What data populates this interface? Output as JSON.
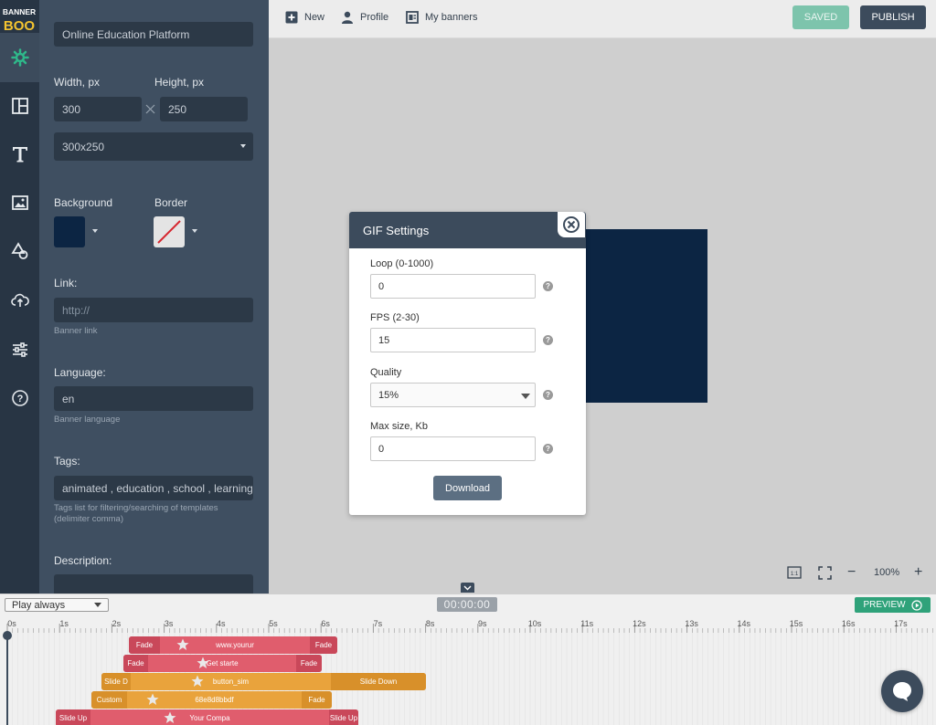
{
  "brand": {
    "logo_text_1": "BANNER",
    "logo_text_2": "BOO"
  },
  "rail": {
    "items": [
      "settings-icon",
      "layout-icon",
      "text-icon",
      "image-icon",
      "shapes-icon",
      "upload-icon",
      "sliders-icon",
      "help-icon"
    ]
  },
  "panel": {
    "banner_name": "Online Education Platform",
    "width_label": "Width, px",
    "height_label": "Height, px",
    "width_value": "300",
    "height_value": "250",
    "size_preset": "300x250",
    "background_label": "Background",
    "border_label": "Border",
    "background_color": "#0c2543",
    "link_label": "Link:",
    "link_placeholder": "http://",
    "link_hint": "Banner link",
    "language_label": "Language:",
    "language_value": "en",
    "language_hint": "Banner language",
    "tags_label": "Tags:",
    "tags_value": "animated , education , school , learning ,",
    "tags_hint": "Tags list for filtering/searching of templates (delimiter comma)",
    "description_label": "Description:"
  },
  "topbar": {
    "new_label": "New",
    "profile_label": "Profile",
    "my_banners_label": "My banners",
    "saved_label": "SAVED",
    "publish_label": "PUBLISH"
  },
  "zoom": {
    "value": "100%",
    "minus": "−",
    "plus": "+",
    "fit_label": "1:1"
  },
  "modal": {
    "title": "GIF Settings",
    "loop_label": "Loop (0-1000)",
    "loop_value": "0",
    "fps_label": "FPS (2-30)",
    "fps_value": "15",
    "quality_label": "Quality",
    "quality_value": "15%",
    "max_size_label": "Max size, Kb",
    "max_size_value": "0",
    "help_glyph": "?",
    "download_label": "Download"
  },
  "timeline": {
    "play_mode": "Play always",
    "timecode": "00:00:00",
    "preview_label": "PREVIEW",
    "ticks": [
      "0s",
      "1s",
      "2s",
      "3s",
      "4s",
      "5s",
      "6s",
      "7s",
      "8s",
      "9s",
      "10s",
      "11s",
      "12s",
      "13s",
      "14s",
      "15s",
      "16s",
      "17s"
    ],
    "layers": [
      {
        "name": "www.yourur",
        "in": "Fade",
        "out": "Fade",
        "color": "red"
      },
      {
        "name": "Get starte",
        "in": "Fade",
        "out": "Fade",
        "color": "red"
      },
      {
        "name": "button_sim",
        "in": "Slide D",
        "out": "Slide Down",
        "color": "orange"
      },
      {
        "name": "68e8d8bbdf",
        "in": "Custom",
        "out": "Fade",
        "color": "orange"
      },
      {
        "name": "Your Compa",
        "in": "Slide Up",
        "out": "Slide Up",
        "color": "red"
      }
    ]
  }
}
